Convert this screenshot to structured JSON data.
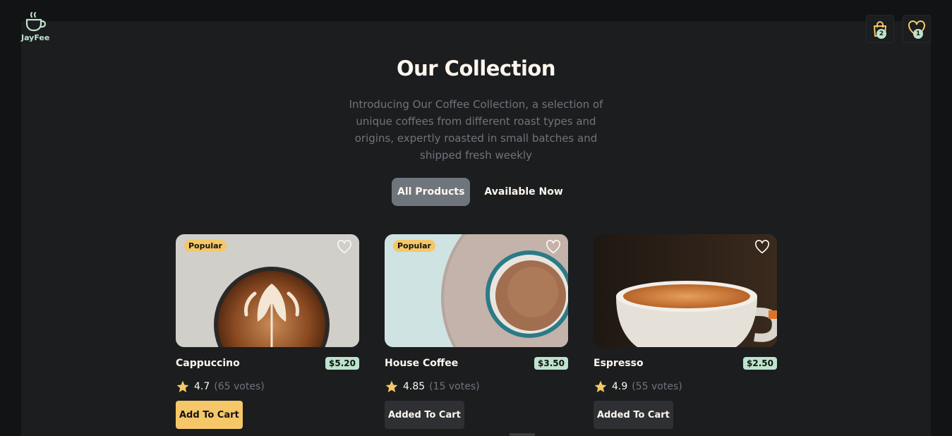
{
  "brand": {
    "name": "JayFee"
  },
  "header": {
    "cart_count": "2",
    "favorites_count": "1"
  },
  "hero": {
    "title": "Our Collection",
    "subtitle": "Introducing Our Coffee Collection, a selection of unique coffees from different roast types and origins, expertly roasted in small batches and shipped fresh weekly"
  },
  "filters": {
    "all": "All Products",
    "available": "Available Now",
    "active": "all"
  },
  "products": [
    {
      "name": "Cappuccino",
      "price": "$5.20",
      "rating": "4.7",
      "votes": "(65 votes)",
      "badge": "Popular",
      "button": "Add To Cart",
      "added": false
    },
    {
      "name": "House Coffee",
      "price": "$3.50",
      "rating": "4.85",
      "votes": "(15 votes)",
      "badge": "Popular",
      "button": "Added To Cart",
      "added": true
    },
    {
      "name": "Espresso",
      "price": "$2.50",
      "rating": "4.9",
      "votes": "(55 votes)",
      "badge": "",
      "button": "Added To Cart",
      "added": true
    }
  ],
  "colors": {
    "accent": "#F6C768",
    "mint": "#BEE3CC",
    "panel": "#1B1D1F",
    "bg": "#111315"
  }
}
